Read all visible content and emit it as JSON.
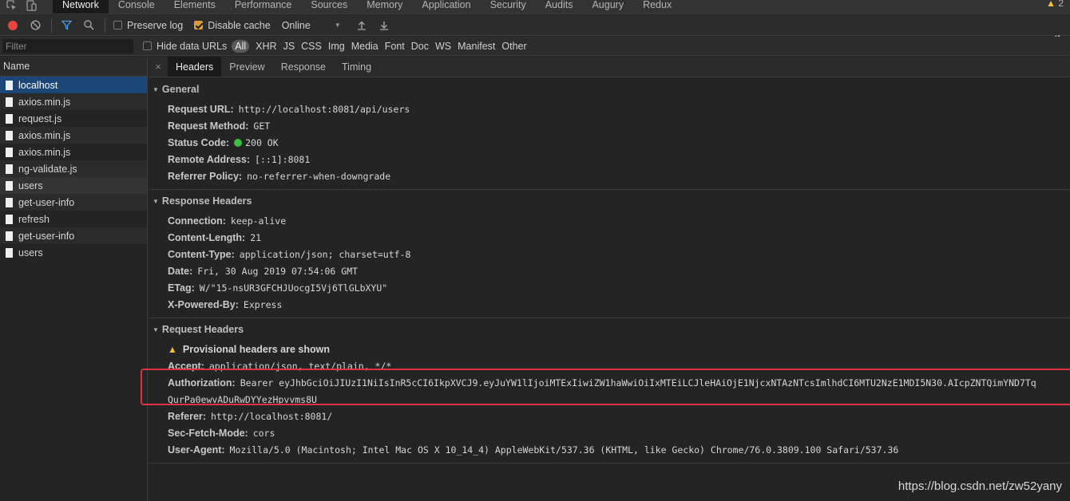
{
  "topbar": {
    "tabs": [
      "Network",
      "Console",
      "Elements",
      "Performance",
      "Sources",
      "Memory",
      "Application",
      "Security",
      "Audits",
      "Augury",
      "Redux"
    ],
    "active_tab": "Network",
    "warning_count": "2"
  },
  "toolbar": {
    "preserve_log": "Preserve log",
    "disable_cache": "Disable cache",
    "throttle": "Online"
  },
  "filterbar": {
    "placeholder": "Filter",
    "hide_data_urls": "Hide data URLs",
    "types": [
      "All",
      "XHR",
      "JS",
      "CSS",
      "Img",
      "Media",
      "Font",
      "Doc",
      "WS",
      "Manifest",
      "Other"
    ]
  },
  "requests": {
    "header": "Name",
    "items": [
      "localhost",
      "axios.min.js",
      "request.js",
      "axios.min.js",
      "axios.min.js",
      "ng-validate.js",
      "users",
      "get-user-info",
      "refresh",
      "get-user-info",
      "users"
    ]
  },
  "detail_tabs": [
    "Headers",
    "Preview",
    "Response",
    "Timing"
  ],
  "general": {
    "title": "General",
    "request_url_k": "Request URL:",
    "request_url_v": "http://localhost:8081/api/users",
    "method_k": "Request Method:",
    "method_v": "GET",
    "status_k": "Status Code:",
    "status_v": "200 OK",
    "remote_k": "Remote Address:",
    "remote_v": "[::1]:8081",
    "referrer_k": "Referrer Policy:",
    "referrer_v": "no-referrer-when-downgrade"
  },
  "response_headers": {
    "title": "Response Headers",
    "rows": [
      {
        "k": "Connection:",
        "v": "keep-alive"
      },
      {
        "k": "Content-Length:",
        "v": "21"
      },
      {
        "k": "Content-Type:",
        "v": "application/json; charset=utf-8"
      },
      {
        "k": "Date:",
        "v": "Fri, 30 Aug 2019 07:54:06 GMT"
      },
      {
        "k": "ETag:",
        "v": "W/\"15-nsUR3GFCHJUocgI5Vj6TlGLbXYU\""
      },
      {
        "k": "X-Powered-By:",
        "v": "Express"
      }
    ]
  },
  "request_headers": {
    "title": "Request Headers",
    "provisional": "Provisional headers are shown",
    "accept_k": "Accept:",
    "accept_v": "application/json, text/plain, */*",
    "auth_k": "Authorization:",
    "auth_v1": "Bearer eyJhbGciOiJIUzI1NiIsInR5cCI6IkpXVCJ9.eyJuYW1lIjoiMTExIiwiZW1haWwiOiIxMTEiLCJleHAiOjE1NjcxNTAzNTcsImlhdCI6MTU2NzE1MDI5N30.AIcpZNTQimYND7Tq",
    "auth_v2": "QurPa0ewvADuRwDYYezHpvvms8U",
    "referer_k": "Referer:",
    "referer_v": "http://localhost:8081/",
    "fetch_k": "Sec-Fetch-Mode:",
    "fetch_v": "cors",
    "ua_k": "User-Agent:",
    "ua_v": "Mozilla/5.0 (Macintosh; Intel Mac OS X 10_14_4) AppleWebKit/537.36 (KHTML, like Gecko) Chrome/76.0.3809.100 Safari/537.36"
  },
  "watermark": "https://blog.csdn.net/zw52yany",
  "colors": {
    "selected": "#1a4778",
    "highlight_box": "#e0323c",
    "status_ok": "#3fbf3f"
  }
}
